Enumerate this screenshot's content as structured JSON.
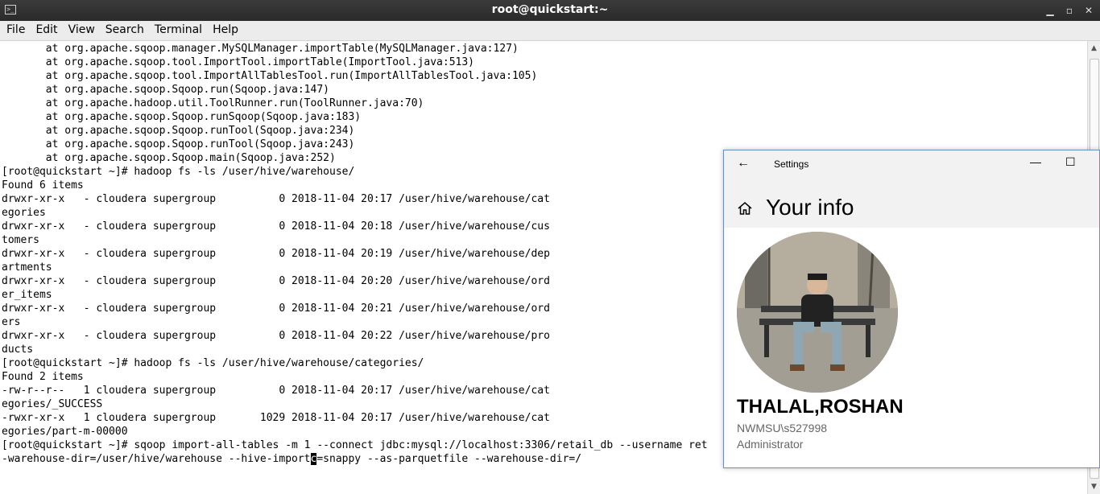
{
  "window": {
    "title": "root@quickstart:~",
    "icon": "terminal-app-icon",
    "controls": [
      "minimize-icon",
      "maximize-icon",
      "close-icon"
    ],
    "control_glyphs": [
      "▁",
      "▫",
      "✕"
    ]
  },
  "menu": [
    "File",
    "Edit",
    "View",
    "Search",
    "Terminal",
    "Help"
  ],
  "terminal": {
    "lines": [
      "       at org.apache.sqoop.manager.MySQLManager.importTable(MySQLManager.java:127)",
      "       at org.apache.sqoop.tool.ImportTool.importTable(ImportTool.java:513)",
      "       at org.apache.sqoop.tool.ImportAllTablesTool.run(ImportAllTablesTool.java:105)",
      "       at org.apache.sqoop.Sqoop.run(Sqoop.java:147)",
      "       at org.apache.hadoop.util.ToolRunner.run(ToolRunner.java:70)",
      "       at org.apache.sqoop.Sqoop.runSqoop(Sqoop.java:183)",
      "       at org.apache.sqoop.Sqoop.runTool(Sqoop.java:234)",
      "       at org.apache.sqoop.Sqoop.runTool(Sqoop.java:243)",
      "       at org.apache.sqoop.Sqoop.main(Sqoop.java:252)",
      "[root@quickstart ~]# hadoop fs -ls /user/hive/warehouse/",
      "Found 6 items",
      "drwxr-xr-x   - cloudera supergroup          0 2018-11-04 20:17 /user/hive/warehouse/cat",
      "egories",
      "drwxr-xr-x   - cloudera supergroup          0 2018-11-04 20:18 /user/hive/warehouse/cus",
      "tomers",
      "drwxr-xr-x   - cloudera supergroup          0 2018-11-04 20:19 /user/hive/warehouse/dep",
      "artments",
      "drwxr-xr-x   - cloudera supergroup          0 2018-11-04 20:20 /user/hive/warehouse/ord",
      "er_items",
      "drwxr-xr-x   - cloudera supergroup          0 2018-11-04 20:21 /user/hive/warehouse/ord",
      "ers",
      "drwxr-xr-x   - cloudera supergroup          0 2018-11-04 20:22 /user/hive/warehouse/pro",
      "ducts",
      "[root@quickstart ~]# hadoop fs -ls /user/hive/warehouse/categories/",
      "Found 2 items",
      "-rw-r--r--   1 cloudera supergroup          0 2018-11-04 20:17 /user/hive/warehouse/cat",
      "egories/_SUCCESS",
      "-rwxr-xr-x   1 cloudera supergroup       1029 2018-11-04 20:17 /user/hive/warehouse/cat",
      "egories/part-m-00000",
      "[root@quickstart ~]# sqoop import-all-tables -m 1 --connect jdbc:mysql://localhost:3306/retail_db --username ret"
    ],
    "last_line_before_cursor": "-warehouse-dir=/user/hive/warehouse --hive-import",
    "cursor_char": "c",
    "last_line_after_cursor": "=snappy --as-parquetfile --warehouse-dir=/"
  },
  "scrollbar": {
    "up_icon": "▲",
    "down_icon": "▼"
  },
  "settings": {
    "app_title": "Settings",
    "back_icon": "←",
    "minimize_icon": "—",
    "maximize_icon": "☐",
    "heading": "Your info",
    "user_name": "THALAL,ROSHAN",
    "user_id": "NWMSU\\s527998",
    "role": "Administrator"
  }
}
